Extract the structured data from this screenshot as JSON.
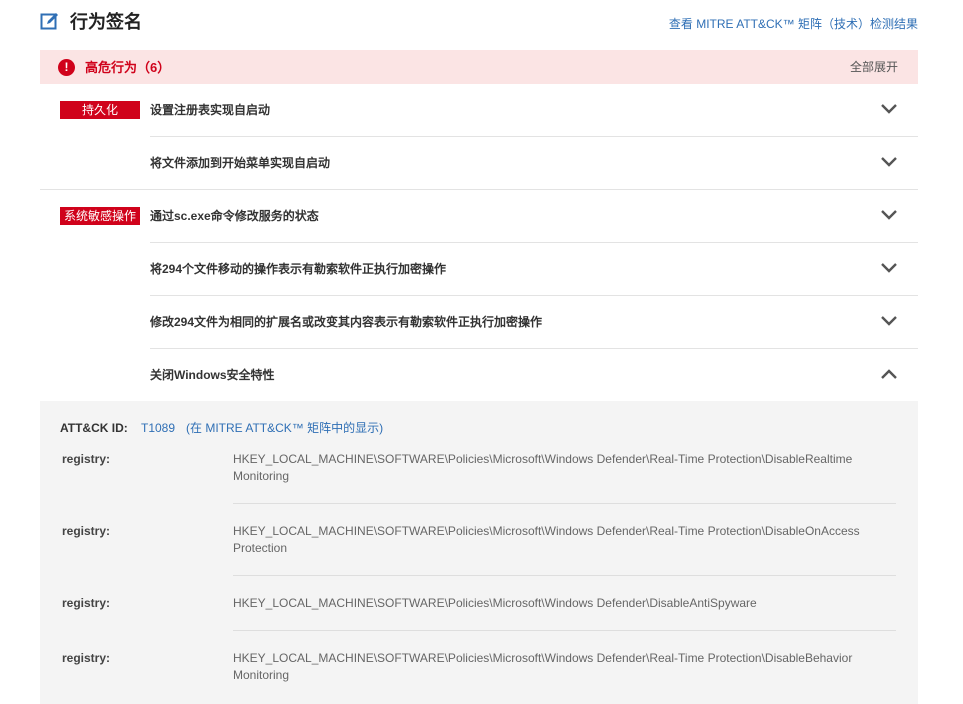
{
  "header": {
    "title": "行为签名",
    "mitre_link": "查看 MITRE ATT&CK™ 矩阵（技术）检测结果"
  },
  "alert": {
    "icon": "!",
    "label": "高危行为（6）",
    "expand_all": "全部展开"
  },
  "groups": [
    {
      "tag": "持久化",
      "items": [
        "设置注册表实现自启动",
        "将文件添加到开始菜单实现自启动"
      ]
    },
    {
      "tag": "系统敏感操作",
      "items": [
        "通过sc.exe命令修改服务的状态",
        "将294个文件移动的操作表示有勒索软件正执行加密操作",
        "修改294文件为相同的扩展名或改变其内容表示有勒索软件正执行加密操作",
        "关闭Windows安全特性"
      ]
    }
  ],
  "detail": {
    "att_label": "ATT&CK ID:",
    "att_id": "T1089",
    "att_show": "(在 MITRE ATT&CK™ 矩阵中的显示)",
    "registry": [
      {
        "key": "registry:",
        "line1": "HKEY_LOCAL_MACHINE\\SOFTWARE\\Policies\\Microsoft\\Windows Defender\\Real-Time Protection\\DisableRealtime",
        "line2": "Monitoring"
      },
      {
        "key": "registry:",
        "line1": "HKEY_LOCAL_MACHINE\\SOFTWARE\\Policies\\Microsoft\\Windows Defender\\Real-Time Protection\\DisableOnAccess",
        "line2": "Protection"
      },
      {
        "key": "registry:",
        "line1": "HKEY_LOCAL_MACHINE\\SOFTWARE\\Policies\\Microsoft\\Windows Defender\\DisableAntiSpyware",
        "line2": ""
      },
      {
        "key": "registry:",
        "line1": "HKEY_LOCAL_MACHINE\\SOFTWARE\\Policies\\Microsoft\\Windows Defender\\Real-Time Protection\\DisableBehavior",
        "line2": "Monitoring"
      }
    ]
  },
  "colors": {
    "accent_red": "#d0021b",
    "link_blue": "#2f6fb5",
    "alert_bg": "#fbe4e4",
    "detail_bg": "#f4f4f4"
  },
  "icons": {
    "title_icon": "edit-icon",
    "collapsed": "chevron-down-icon",
    "expanded": "chevron-up-icon"
  }
}
